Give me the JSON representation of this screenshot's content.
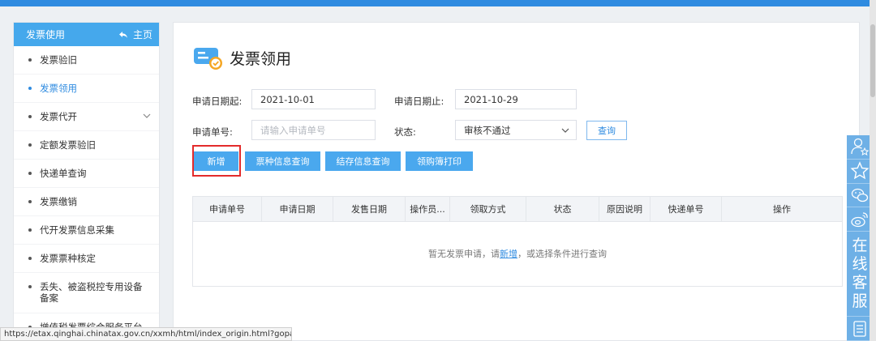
{
  "sidebar": {
    "title": "发票使用",
    "home_label": "主页",
    "items": [
      {
        "label": "发票验旧"
      },
      {
        "label": "发票领用"
      },
      {
        "label": "发票代开"
      },
      {
        "label": "定额发票验旧"
      },
      {
        "label": "快递单查询"
      },
      {
        "label": "发票缴销"
      },
      {
        "label": "代开发票信息采集"
      },
      {
        "label": "发票票种核定"
      },
      {
        "label": "丢失、被盗税控专用设备备案"
      },
      {
        "label": "增值税发票综合服务平台"
      }
    ],
    "active_index": 1
  },
  "page": {
    "title": "发票领用"
  },
  "form": {
    "start_date_label": "申请日期起:",
    "start_date_value": "2021-10-01",
    "end_date_label": "申请日期止:",
    "end_date_value": "2021-10-29",
    "apply_no_label": "申请单号:",
    "apply_no_placeholder": "请输入申请单号",
    "status_label": "状态:",
    "status_value": "审核不通过",
    "query_label": "查询"
  },
  "actions": {
    "add_label": "新增",
    "type_query_label": "票种信息查询",
    "stock_query_label": "结存信息查询",
    "purchase_print_label": "领购簿打印"
  },
  "table": {
    "headers": [
      "申请单号",
      "申请日期",
      "发售日期",
      "操作员...",
      "领取方式",
      "状态",
      "原因说明",
      "快递单号",
      "操作"
    ],
    "empty_prefix": "暂无发票申请，请",
    "empty_link": "新增",
    "empty_suffix": "，或选择条件进行查询"
  },
  "float_bar": {
    "service_chars": [
      "在",
      "线",
      "客",
      "服"
    ]
  },
  "status_bar": {
    "url": "https://etax.qinghai.chinatax.gov.cn/xxmh/html/index_origin.html?gopage..."
  },
  "colors": {
    "accent": "#45a8ec",
    "button": "#4aa8ee",
    "link": "#2f8be0",
    "highlight": "#e32b2b"
  }
}
